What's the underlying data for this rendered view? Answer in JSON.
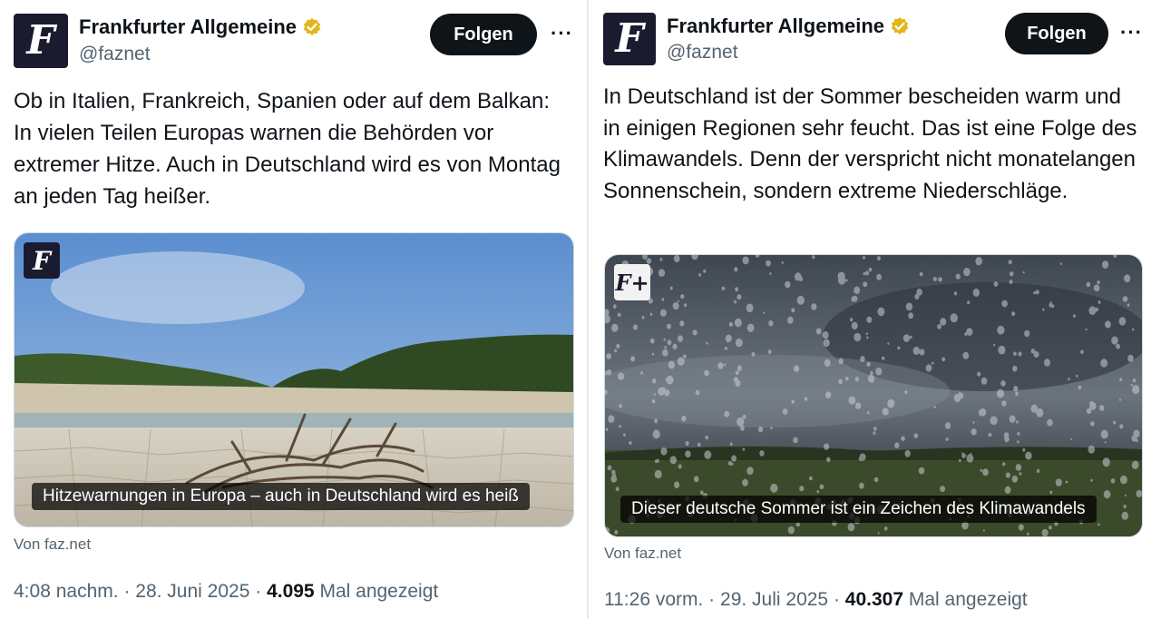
{
  "tweets": [
    {
      "avatar_glyph": "F",
      "account_name": "Frankfurter Allgemeine",
      "handle": "@faznet",
      "follow_label": "Folgen",
      "more_label": "···",
      "text": "Ob in Italien, Frankreich, Spanien oder auf dem Balkan: In vielen Teilen Europas warnen die Behörden vor extremer Hitze. Auch in Deutschland wird es von Montag an jeden Tag heißer.",
      "card": {
        "badge": "F",
        "caption": "Hitzewarnungen in Europa – auch in Deutschland wird es heiß",
        "source": "Von faz.net"
      },
      "time": "4:08 nachm.",
      "date": "28. Juni 2025",
      "views": "4.095",
      "views_suffix": "Mal angezeigt",
      "separator": "·"
    },
    {
      "avatar_glyph": "F",
      "account_name": "Frankfurter Allgemeine",
      "handle": "@faznet",
      "follow_label": "Folgen",
      "more_label": "···",
      "text": "In Deutschland ist der Sommer bescheiden warm und in einigen Regionen sehr feucht. Das ist eine Folge des Klimawandels. Denn der verspricht nicht monatelangen Sonnenschein, sondern extreme Niederschläge.",
      "card": {
        "badge": "F+",
        "caption": "Dieser deutsche Sommer ist ein Zeichen des Klimawandels",
        "source": "Von faz.net"
      },
      "time": "11:26 vorm.",
      "date": "29. Juli 2025",
      "views": "40.307",
      "views_suffix": "Mal angezeigt",
      "separator": "·"
    }
  ],
  "colors": {
    "verified_gold": "#e2b719",
    "avatar_bg": "#1b1b2f",
    "muted_text": "#536471"
  }
}
